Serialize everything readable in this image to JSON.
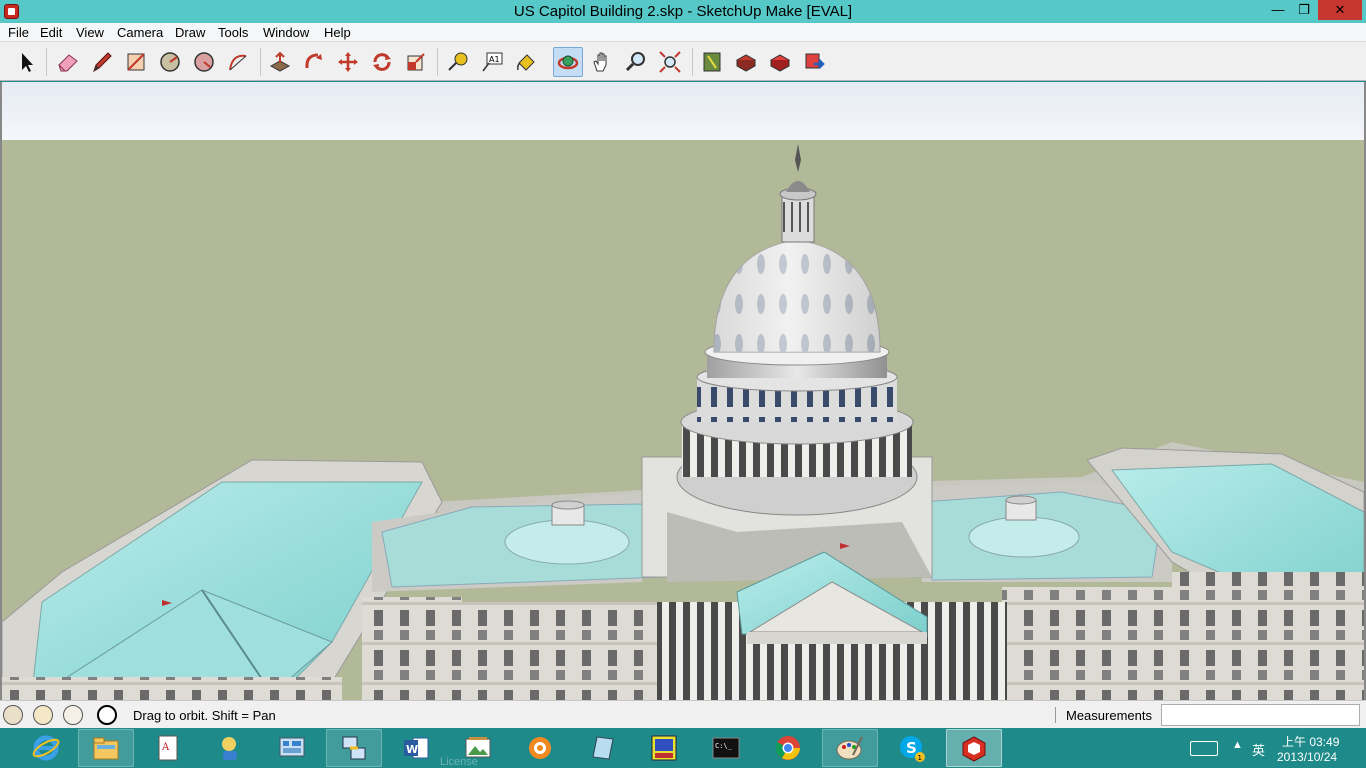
{
  "window": {
    "title": "US Capitol Building 2.skp - SketchUp Make [EVAL]",
    "minimize_glyph": "—",
    "maximize_glyph": "❐",
    "close_glyph": "✕"
  },
  "menu": {
    "items": [
      "File",
      "Edit",
      "View",
      "Camera",
      "Draw",
      "Tools",
      "Window",
      "Help"
    ]
  },
  "toolbar": {
    "tools": [
      {
        "name": "select-tool-icon"
      },
      {
        "name": "eraser-tool-icon"
      },
      {
        "name": "pencil-line-tool-icon"
      },
      {
        "name": "rectangle-tool-icon"
      },
      {
        "name": "circle-tool-icon"
      },
      {
        "name": "polygon-tool-icon"
      },
      {
        "name": "arc-tool-icon"
      },
      {
        "name": "push-pull-tool-icon"
      },
      {
        "name": "follow-me-tool-icon"
      },
      {
        "name": "move-tool-icon"
      },
      {
        "name": "rotate-tool-icon"
      },
      {
        "name": "scale-tool-icon"
      },
      {
        "name": "tape-measure-tool-icon"
      },
      {
        "name": "text-tool-icon",
        "label": "A1"
      },
      {
        "name": "paint-bucket-tool-icon"
      },
      {
        "name": "orbit-tool-icon",
        "active": true
      },
      {
        "name": "pan-tool-icon"
      },
      {
        "name": "zoom-tool-icon"
      },
      {
        "name": "zoom-extents-tool-icon"
      },
      {
        "name": "3d-warehouse-icon"
      },
      {
        "name": "share-model-icon"
      },
      {
        "name": "get-components-icon"
      },
      {
        "name": "share-component-icon"
      }
    ]
  },
  "status": {
    "hint": "Drag to orbit.  Shift = Pan",
    "measurements_label": "Measurements",
    "measurements_value": ""
  },
  "taskbar": {
    "apps": [
      {
        "name": "internet-explorer-icon",
        "state": "pinned"
      },
      {
        "name": "file-explorer-icon",
        "state": "open"
      },
      {
        "name": "document-viewer-icon",
        "state": "pinned"
      },
      {
        "name": "messenger-icon",
        "state": "pinned"
      },
      {
        "name": "control-panel-icon",
        "state": "pinned"
      },
      {
        "name": "network-tool-icon",
        "state": "open"
      },
      {
        "name": "word-icon",
        "state": "pinned"
      },
      {
        "name": "photo-viewer-icon",
        "state": "pinned"
      },
      {
        "name": "xsplit-icon",
        "state": "pinned"
      },
      {
        "name": "notepad-icon",
        "state": "pinned"
      },
      {
        "name": "game-app-icon",
        "state": "pinned"
      },
      {
        "name": "command-prompt-icon",
        "state": "pinned"
      },
      {
        "name": "chrome-icon",
        "state": "pinned"
      },
      {
        "name": "paint-icon",
        "state": "open"
      },
      {
        "name": "skype-icon",
        "state": "pinned",
        "badge": "1"
      },
      {
        "name": "sketchup-icon",
        "state": "active"
      }
    ],
    "ghost_text": "License",
    "ime": "英",
    "time": "上午 03:49",
    "date": "2013/10/24"
  },
  "colors": {
    "sky": "#ecf0f6",
    "ground": "#b2b998",
    "roof": "#9fe0de",
    "marble": "#e4e4e0",
    "taskbar": "#1e8a8a",
    "titlebar": "#56c8c8"
  }
}
